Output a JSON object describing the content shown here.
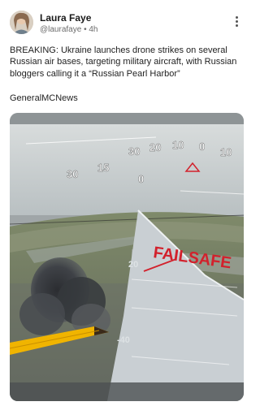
{
  "author": {
    "display_name": "Laura Faye",
    "handle": "@laurafaye",
    "separator": "•",
    "age": "4h"
  },
  "post": {
    "text": "BREAKING: Ukraine launches drone strikes on several Russian air bases, targeting military aircraft, with Russian bloggers calling it a “Russian Pearl Harbor”",
    "source": "GeneralMCNews"
  },
  "video_overlay": {
    "heading_ticks": [
      "30",
      "20",
      "10",
      "0",
      "10"
    ],
    "left_ticks": [
      "30",
      "15",
      "0"
    ],
    "center_mark": "0",
    "wing_label": "FAILSAFE",
    "pitch_marks": [
      "20",
      "-40"
    ]
  },
  "icons": {
    "menu": "more-vertical-icon",
    "avatar": "avatar-image"
  },
  "colors": {
    "failsafe": "#d2212c",
    "pencil": "#f0b400"
  }
}
